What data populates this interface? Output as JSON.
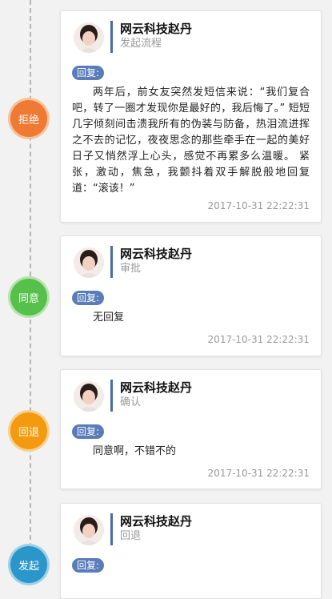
{
  "reply_label": "回复:",
  "entries": [
    {
      "status": "拒绝",
      "status_color": "#ee7a33",
      "name": "网云科技赵丹",
      "role": "发起流程",
      "content": "两年后，前女友突然发短信来说：“我们复合吧，转了一圈才发现你是最好的，我后悔了。” 短短几字倾刻间击溃我所有的伪装与防备，热泪流进挥之不去的记忆，夜夜思念的那些牵手在一起的美好日子又悄然浮上心头，感觉不再累多么温暖。 紧张，激动，焦急，我颤抖着双手解脱般地回复道：“滚该！”",
      "timestamp": "2017-10-31 22:22:31"
    },
    {
      "status": "同意",
      "status_color": "#56c04b",
      "name": "网云科技赵丹",
      "role": "审批",
      "content": "无回复",
      "timestamp": "2017-10-31 22:22:31"
    },
    {
      "status": "回退",
      "status_color": "#f39a11",
      "name": "网云科技赵丹",
      "role": "确认",
      "content": "同意啊，不错不的",
      "timestamp": "2017-10-31 22:22:31"
    },
    {
      "status": "发起",
      "status_color": "#2a96c9",
      "name": "网云科技赵丹",
      "role": "回退",
      "content": "",
      "timestamp": ""
    }
  ]
}
